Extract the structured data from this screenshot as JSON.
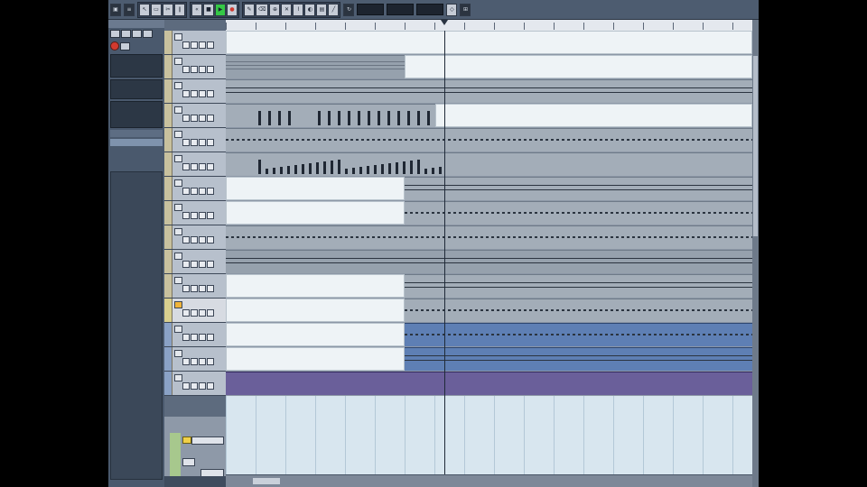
{
  "window": {
    "title": ""
  },
  "toolbar": {
    "transport_position": "",
    "tempo": "",
    "signature": ""
  },
  "inspector": {
    "header": "",
    "items": []
  },
  "tracks": [
    {
      "name": "",
      "type": "audio"
    },
    {
      "name": "",
      "type": "audio"
    },
    {
      "name": "",
      "type": "audio"
    },
    {
      "name": "",
      "type": "audio"
    },
    {
      "name": "",
      "type": "audio"
    },
    {
      "name": "",
      "type": "audio"
    },
    {
      "name": "",
      "type": "audio"
    },
    {
      "name": "",
      "type": "audio"
    },
    {
      "name": "",
      "type": "audio"
    },
    {
      "name": "",
      "type": "audio"
    },
    {
      "name": "",
      "type": "audio"
    },
    {
      "name": "",
      "type": "midi",
      "selected": true
    },
    {
      "name": "",
      "type": "midi"
    },
    {
      "name": "",
      "type": "midi"
    },
    {
      "name": "",
      "type": "midi"
    }
  ],
  "status": {
    "text": ""
  },
  "icons": {
    "record": "record-icon",
    "play": "play-icon",
    "stop": "stop-icon",
    "loop": "loop-icon"
  },
  "colors": {
    "toolbar": "#4d5c70",
    "inspector": "#4a596d",
    "arrange_bg": "#d8e6ef",
    "audio_part": "#a3adb8",
    "midi_part": "#5e7fb4",
    "selected_part": "#6a5f9a",
    "record": "#d13a2f",
    "active": "#35c846"
  }
}
